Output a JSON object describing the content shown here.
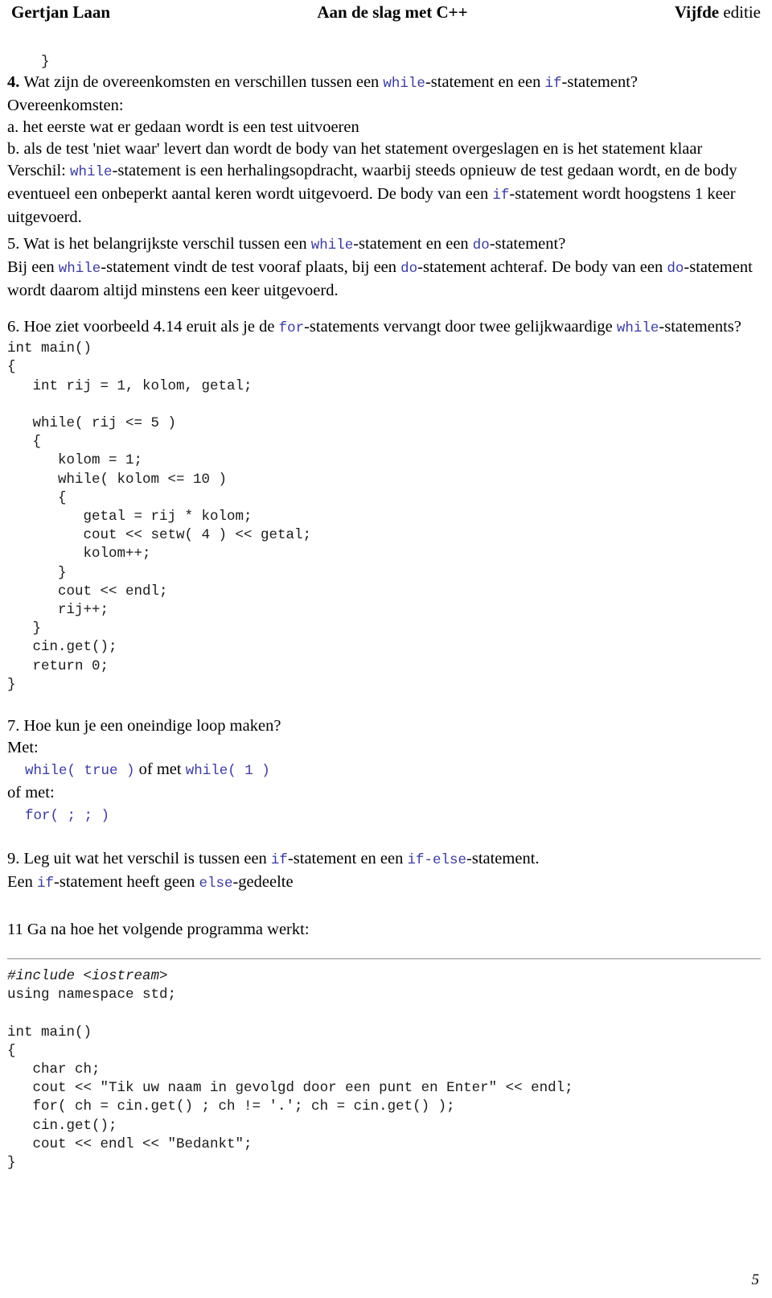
{
  "header": {
    "left": "Gertjan Laan",
    "center": "Aan de slag met C++",
    "right_bold": "Vijfde",
    "right_normal": " editie"
  },
  "page_number": "5",
  "content": {
    "stray_brace": "    }",
    "q4": {
      "number": "4. ",
      "text_a": "Wat zijn de overeenkomsten en verschillen tussen een ",
      "kw1": "while",
      "text_b": "-statement en een ",
      "kw2": "if",
      "text_c": "-statement?",
      "overeenkomsten_label": "Overeenkomsten:",
      "item_a": "a. het eerste wat er gedaan wordt is een test uitvoeren",
      "item_b": "b. als de test 'niet waar' levert dan wordt de body van het statement overgeslagen en is het statement klaar",
      "verschil_pre": "Verschil: ",
      "verschil_kw1": "while",
      "verschil_mid": "-statement is een herhalingsopdracht, waarbij steeds opnieuw de test gedaan wordt, en de body eventueel een onbeperkt aantal keren wordt uitgevoerd. De body van een ",
      "verschil_kw2": "if",
      "verschil_end": "-statement wordt hoogstens 1 keer uitgevoerd."
    },
    "q5": {
      "number": "5. ",
      "q_a": "Wat is het belangrijkste verschil tussen een ",
      "q_kw1": "while",
      "q_b": "-statement en een ",
      "q_kw2": "do",
      "q_c": "-statement?",
      "a_a": "Bij een ",
      "a_kw1": "while",
      "a_b": "-statement vindt de test vooraf plaats, bij een ",
      "a_kw2": "do",
      "a_c": "-statement achteraf. De body van een ",
      "a_kw3": "do",
      "a_d": "-statement wordt daarom altijd minstens een keer uitgevoerd."
    },
    "q6": {
      "number": "6. ",
      "q_a": "Hoe ziet voorbeeld 4.14 eruit als je de ",
      "q_kw1": "for",
      "q_b": "-statements vervangt door twee gelijkwaardige ",
      "q_kw2": "while",
      "q_c": "-statements?",
      "code": "int main()\n{\n   int rij = 1, kolom, getal;\n\n   while( rij <= 5 )\n   {\n      kolom = 1;\n      while( kolom <= 10 )\n      {\n         getal = rij * kolom;\n         cout << setw( 4 ) << getal;\n         kolom++;\n      }\n      cout << endl;\n      rij++;\n   }\n   cin.get();\n   return 0;\n}"
    },
    "q7": {
      "number": "7. ",
      "question": "Hoe kun je een oneindige loop maken?",
      "met_label": "Met:",
      "answer_kw1": "while( true )",
      "answer_mid": " of met ",
      "answer_kw2": "while( 1 )",
      "ofmet_label": "of met:",
      "answer_kw3": "for( ; ; )"
    },
    "q9": {
      "number": "9. ",
      "q_a": "Leg uit wat het verschil is tussen een ",
      "q_kw1": "if",
      "q_b": "-statement en een ",
      "q_kw2": "if-else",
      "q_c": "-statement.",
      "a_a": "Een ",
      "a_kw1": "if",
      "a_b": "-statement heeft geen ",
      "a_kw2": "else",
      "a_c": "-gedeelte"
    },
    "q11": {
      "heading": "11 Ga na hoe het volgende programma werkt:",
      "code_include": "#include <iostream>",
      "code_rest": "using namespace std;\n\nint main()\n{\n   char ch;\n   cout << \"Tik uw naam in gevolgd door een punt en Enter\" << endl;\n   for( ch = cin.get() ; ch != '.'; ch = cin.get() );\n   cin.get();\n   cout << endl << \"Bedankt\";\n}"
    }
  }
}
